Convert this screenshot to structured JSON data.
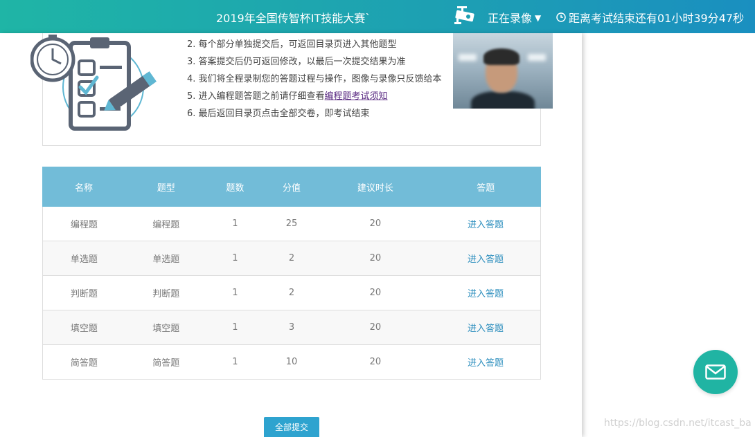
{
  "header": {
    "title": "2019年全国传智杯IT技能大赛`",
    "recording_label": "正在录像",
    "timer_text": "距离考试结束还有01小时39分47秒"
  },
  "rules": [
    "2. 每个部分单独提交后，可返回目录页进入其他题型",
    "3. 答案提交后仍可返回修改，以最后一次提交结果为准",
    "4. 我们将全程录制您的答题过程与操作，图像与录像只反馈给本",
    "5. 进入编程题答题之前请仔细查看",
    "6. 最后返回目录页点击全部交卷，即考试结束"
  ],
  "rules_link": "编程题考试须知",
  "table": {
    "headers": [
      "名称",
      "题型",
      "题数",
      "分值",
      "建议时长",
      "答题"
    ],
    "rows": [
      [
        "编程题",
        "编程题",
        "1",
        "25",
        "20",
        "进入答题"
      ],
      [
        "单选题",
        "单选题",
        "1",
        "2",
        "20",
        "进入答题"
      ],
      [
        "判断题",
        "判断题",
        "1",
        "2",
        "20",
        "进入答题"
      ],
      [
        "填空题",
        "填空题",
        "1",
        "3",
        "20",
        "进入答题"
      ],
      [
        "简答题",
        "简答题",
        "1",
        "10",
        "20",
        "进入答题"
      ]
    ]
  },
  "submit_label": "全部提交",
  "watermark": "https://blog.csdn.net/itcast_ba",
  "icons": [
    "camera-icon",
    "caret-down-icon",
    "clock-icon",
    "clipboard-illustration",
    "mail-icon"
  ],
  "colors": {
    "header_start": "#1fb5a6",
    "header_end": "#1a8fc0",
    "table_header": "#72bcd8",
    "accent": "#2ea3cf",
    "link": "#2a8dbd"
  }
}
